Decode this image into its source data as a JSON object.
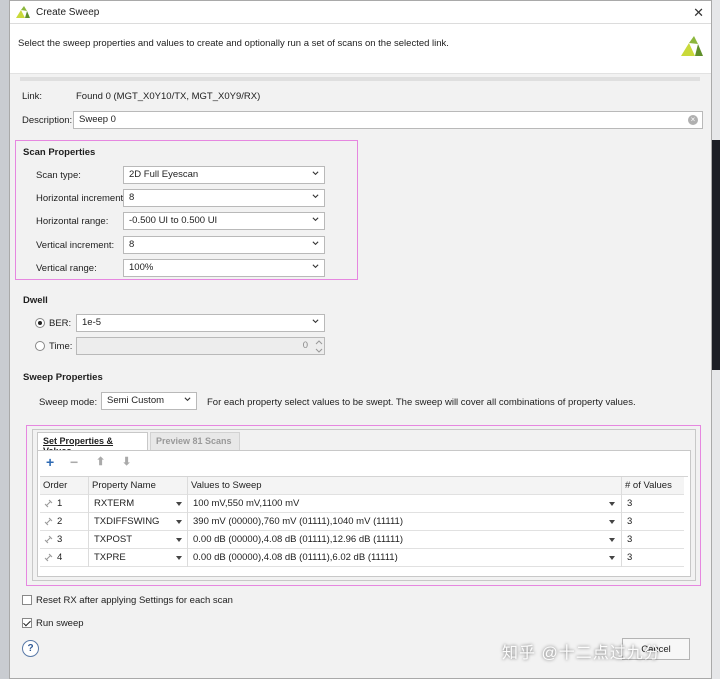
{
  "window": {
    "title": "Create Sweep",
    "close_glyph": "✕"
  },
  "banner": {
    "text": "Select the sweep properties and values to create and optionally run a set of scans on the selected link."
  },
  "link": {
    "label": "Link:",
    "value": "Found 0 (MGT_X0Y10/TX, MGT_X0Y9/RX)"
  },
  "description": {
    "label": "Description:",
    "value": "Sweep 0"
  },
  "scan_properties": {
    "title": "Scan Properties",
    "fields": [
      {
        "label": "Scan type:",
        "value": "2D Full Eyescan"
      },
      {
        "label": "Horizontal increment:",
        "value": "8"
      },
      {
        "label": "Horizontal range:",
        "value": "-0.500 UI to 0.500 UI"
      },
      {
        "label": "Vertical increment:",
        "value": "8"
      },
      {
        "label": "Vertical range:",
        "value": "100%"
      }
    ]
  },
  "dwell": {
    "title": "Dwell",
    "ber": {
      "label": "BER:",
      "value": "1e-5",
      "selected": true
    },
    "time": {
      "label": "Time:",
      "value": "0",
      "selected": false
    }
  },
  "sweep_properties": {
    "title": "Sweep Properties",
    "mode_label": "Sweep mode:",
    "mode_value": "Semi Custom",
    "hint": "For each property select values to be swept. The sweep will cover all combinations of property values."
  },
  "tabs": [
    {
      "label": "Set Properties & Values",
      "active": true
    },
    {
      "label": "Preview 81 Scans",
      "active": false
    }
  ],
  "toolbar": {
    "add": "+",
    "remove": "−",
    "up": "⬆",
    "down": "⬇"
  },
  "table": {
    "headers": [
      "Order",
      "Property Name",
      "Values to Sweep",
      "# of Values"
    ],
    "rows": [
      {
        "order": "1",
        "name": "RXTERM",
        "values": "100 mV,550 mV,1100 mV",
        "count": "3"
      },
      {
        "order": "2",
        "name": "TXDIFFSWING",
        "values": "390 mV (00000),760 mV (01111),1040 mV (11111)",
        "count": "3"
      },
      {
        "order": "3",
        "name": "TXPOST",
        "values": "0.00 dB (00000),4.08 dB (01111),12.96 dB (11111)",
        "count": "3"
      },
      {
        "order": "4",
        "name": "TXPRE",
        "values": "0.00 dB (00000),4.08 dB (01111),6.02 dB (11111)",
        "count": "3"
      }
    ]
  },
  "options": {
    "reset_rx": {
      "label": "Reset RX after applying Settings for each scan",
      "checked": false
    },
    "run_sweep": {
      "label": "Run sweep",
      "checked": true
    }
  },
  "footer": {
    "help": "?",
    "cancel": "Cancel",
    "watermark": "知乎 @十二点过九分"
  },
  "colors": {
    "highlight": "#e687e0",
    "accent": "#2f5a96"
  }
}
